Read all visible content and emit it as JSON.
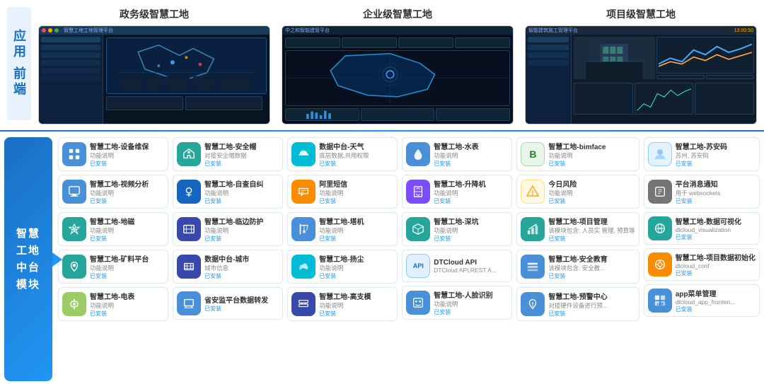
{
  "top": {
    "left_label": "应用\n前端",
    "columns": [
      {
        "title": "政务级智慧工地",
        "bg": "gov"
      },
      {
        "title": "企业级智慧工地",
        "bg": "enterprise"
      },
      {
        "title": "项目级智慧工地",
        "bg": "project"
      }
    ]
  },
  "bottom": {
    "main_label": "智慧\n工地\n中台\n模块",
    "columns": [
      {
        "items": [
          {
            "name": "智慧工地-设备维保",
            "desc": "功能说明",
            "status": "已安装",
            "icon": "grid",
            "color": "ic-blue"
          },
          {
            "name": "智慧工地-视频分析",
            "desc": "功能说明",
            "status": "已安装",
            "icon": "monitor",
            "color": "ic-blue"
          },
          {
            "name": "智慧工地-地磁",
            "desc": "功能说明",
            "status": "已安装",
            "icon": "shield",
            "color": "ic-teal"
          },
          {
            "name": "智慧工地-矿料平台",
            "desc": "功能说明",
            "status": "已安装",
            "icon": "shield2",
            "color": "ic-teal"
          },
          {
            "name": "智慧工地-电表",
            "desc": "功能说明",
            "status": "已安装",
            "icon": "bolt",
            "color": "ic-yellow-green"
          }
        ]
      },
      {
        "items": [
          {
            "name": "智慧工地-安全帽",
            "desc": "对接安全帽数据",
            "status": "已安装",
            "icon": "helmet",
            "color": "ic-teal"
          },
          {
            "name": "智慧工地-自查自纠",
            "desc": "功能说明",
            "status": "已安装",
            "icon": "location",
            "color": "ic-deep-blue"
          },
          {
            "name": "智慧工地-临边防护",
            "desc": "功能说明",
            "status": "已安装",
            "icon": "fence",
            "color": "ic-indigo"
          },
          {
            "name": "数据中台-城市",
            "desc": "城市信息",
            "status": "已安装",
            "icon": "building",
            "color": "ic-indigo"
          },
          {
            "name": "省安监平台数据转发",
            "desc": "",
            "status": "已安装",
            "icon": "mail",
            "color": "ic-blue"
          }
        ]
      },
      {
        "items": [
          {
            "name": "数据中台-天气",
            "desc": "底层数据,共用权限",
            "status": "已安装",
            "icon": "cloud",
            "color": "ic-cyan"
          },
          {
            "name": "阿里短信",
            "desc": "功能说明",
            "status": "已安装",
            "icon": "msg",
            "color": "ic-orange"
          },
          {
            "name": "智慧工地-塔机",
            "desc": "功能说明",
            "status": "已安装",
            "icon": "crane",
            "color": "ic-blue"
          },
          {
            "name": "智慧工地-扬尘",
            "desc": "功能说明",
            "status": "已安装",
            "icon": "dust",
            "color": "ic-cyan"
          },
          {
            "name": "智慧工地-高支模",
            "desc": "功能说明",
            "status": "已安装",
            "icon": "scaffold",
            "color": "ic-indigo"
          }
        ]
      },
      {
        "items": [
          {
            "name": "智慧工地-水表",
            "desc": "功能说明",
            "status": "已安装",
            "icon": "drop",
            "color": "ic-blue"
          },
          {
            "name": "智慧工地-升降机",
            "desc": "功能说明",
            "status": "已安装",
            "icon": "elevator",
            "color": "ic-purple"
          },
          {
            "name": "智慧工地-深坑",
            "desc": "功能说明",
            "status": "已安装",
            "icon": "deep",
            "color": "ic-teal"
          },
          {
            "name": "DTCloud API",
            "desc": "DTCloud API,REST A...",
            "status": "",
            "icon": "api",
            "color": "ic-api"
          },
          {
            "name": "智慧工地-人脸识别",
            "desc": "功能说明",
            "status": "已安装",
            "icon": "face",
            "color": "ic-blue"
          }
        ]
      },
      {
        "items": [
          {
            "name": "智慧工地-bimface",
            "desc": "功能说明",
            "status": "已安装",
            "icon": "bimface",
            "color": "bimface"
          },
          {
            "name": "今日风险",
            "desc": "功能说明",
            "status": "已安装",
            "icon": "risk",
            "color": "ic-amber"
          },
          {
            "name": "智慧工地-项目管理",
            "desc": "该模块包含: 人员实\n管理, 预算等",
            "status": "已安装",
            "icon": "chart-bar",
            "color": "ic-teal"
          },
          {
            "name": "智慧工地-安全教育",
            "desc": "该模块包含: 安全教...",
            "status": "已安装",
            "icon": "layers",
            "color": "ic-blue"
          },
          {
            "name": "智慧工地-预警中心",
            "desc": "对接硬件设备进行预...",
            "status": "已安装",
            "icon": "warning-lock",
            "color": "ic-blue"
          }
        ]
      },
      {
        "items": [
          {
            "name": "智慧工地-苏安码",
            "desc": "苏州, 苏安码",
            "status": "已安装",
            "icon": "avatar",
            "color": "ic-blue"
          },
          {
            "name": "平台消息通知",
            "desc": "用于 websockets",
            "status": "已安装",
            "icon": "box",
            "color": "ic-gray"
          },
          {
            "name": "智慧工地-数据可视化",
            "desc": "dtcloud_visualization",
            "status": "已安装",
            "icon": "eye-chart",
            "color": "ic-teal"
          },
          {
            "name": "智慧工地-项目数据初始化",
            "desc": "dtcloud_conf",
            "status": "已安装",
            "icon": "gear-data",
            "color": "ic-orange"
          },
          {
            "name": "app菜单管理",
            "desc": "dtcloud_app_fronten...",
            "status": "已安装",
            "icon": "app-store",
            "color": "ic-blue"
          }
        ]
      }
    ]
  }
}
